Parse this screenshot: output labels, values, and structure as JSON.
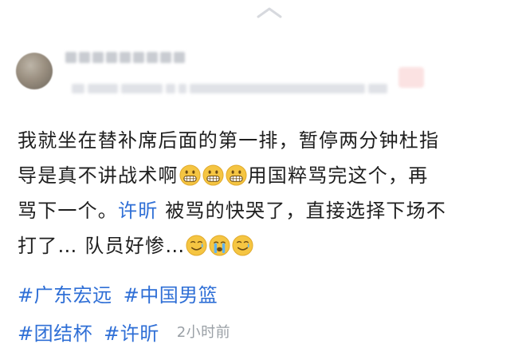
{
  "post": {
    "line1": "我就坐在替补席后面的第一排，暂停两分钟杜指",
    "line2_a": "导是真不讲战术啊",
    "line2_b": "用国粹骂完这个，再",
    "line3_a": "骂下一个。",
    "mention": "许昕",
    "line3_b": " 被骂的快哭了，直接选择下场不",
    "line4": "打了… 队员好惨…",
    "emojis_row1": [
      "grimace-emoji",
      "grimace-emoji",
      "grimace-emoji"
    ],
    "emojis_row2": [
      "tear-smile-emoji",
      "crying-emoji",
      "tear-smile-emoji"
    ]
  },
  "tags": {
    "row1": [
      "#广东宏远",
      "#中国男篮"
    ],
    "row2": [
      "#团结杯",
      "#许昕"
    ]
  },
  "timestamp": "2小时前",
  "colors": {
    "link": "#2f6fd6",
    "text": "#1f1f1f",
    "muted": "#9aa0a6",
    "emoji_face": "#f5c542"
  },
  "icons": {
    "collapse": "chevron-up-icon"
  }
}
